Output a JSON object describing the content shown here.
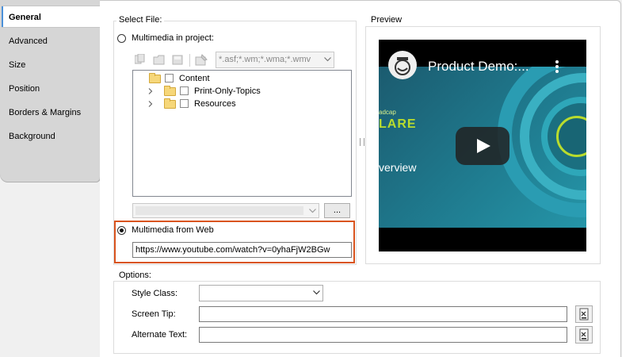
{
  "sidebar": {
    "tabs": [
      {
        "label": "General",
        "active": true
      },
      {
        "label": "Advanced"
      },
      {
        "label": "Size"
      },
      {
        "label": "Position"
      },
      {
        "label": "Borders & Margins"
      },
      {
        "label": "Background"
      }
    ]
  },
  "select_file": {
    "legend": "Select File:",
    "project_option_label": "Multimedia in project:",
    "filter_value": "*.asf;*.wm;*.wma;*.wmv",
    "tree": [
      {
        "label": "Content",
        "expandable": false
      },
      {
        "label": "Print-Only-Topics",
        "expandable": true
      },
      {
        "label": "Resources",
        "expandable": true
      }
    ],
    "browse_label": "...",
    "web_option_label": "Multimedia from Web",
    "web_url": "https://www.youtube.com/watch?v=0yhaFjW2BGw",
    "selected": "web"
  },
  "preview": {
    "legend": "Preview",
    "video_title": "Product Demo:...",
    "brand_partial_1": "adcap",
    "brand_partial_2": "LARE",
    "brand_partial_3": "verview"
  },
  "options": {
    "legend": "Options:",
    "style_class_label": "Style Class:",
    "style_class_value": "",
    "screen_tip_label": "Screen Tip:",
    "screen_tip_value": "",
    "alternate_text_label": "Alternate Text:",
    "alternate_text_value": ""
  },
  "colors": {
    "highlight": "#d9541e",
    "active_tab_accent": "#4a90d9"
  }
}
